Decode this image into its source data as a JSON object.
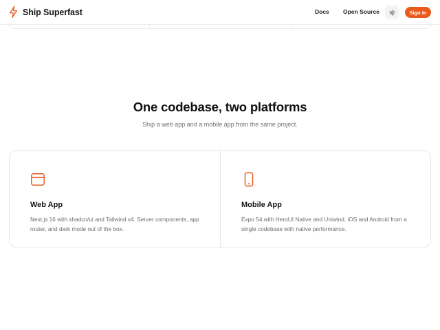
{
  "header": {
    "brand_name": "Ship Superfast",
    "nav": [
      {
        "label": "Docs"
      },
      {
        "label": "Open Source"
      }
    ],
    "theme_toggle_icon": "sun-icon",
    "signin_label": "Sign In"
  },
  "section": {
    "title": "One codebase, two platforms",
    "subtitle": "Ship a web app and a mobile app from the same project."
  },
  "cards": [
    {
      "icon": "browser-window-icon",
      "title": "Web App",
      "description": "Next.js 16 with shadcn/ui and Tailwind v4. Server components, app router, and dark mode out of the box."
    },
    {
      "icon": "smartphone-icon",
      "title": "Mobile App",
      "description": "Expo 54 with HeroUI Native and Uniwind. iOS and Android from a single codebase with native performance."
    }
  ],
  "colors": {
    "accent": "#ea5a1c",
    "text": "#111111",
    "muted": "#6b6b6b",
    "border": "#e8e8e8"
  }
}
